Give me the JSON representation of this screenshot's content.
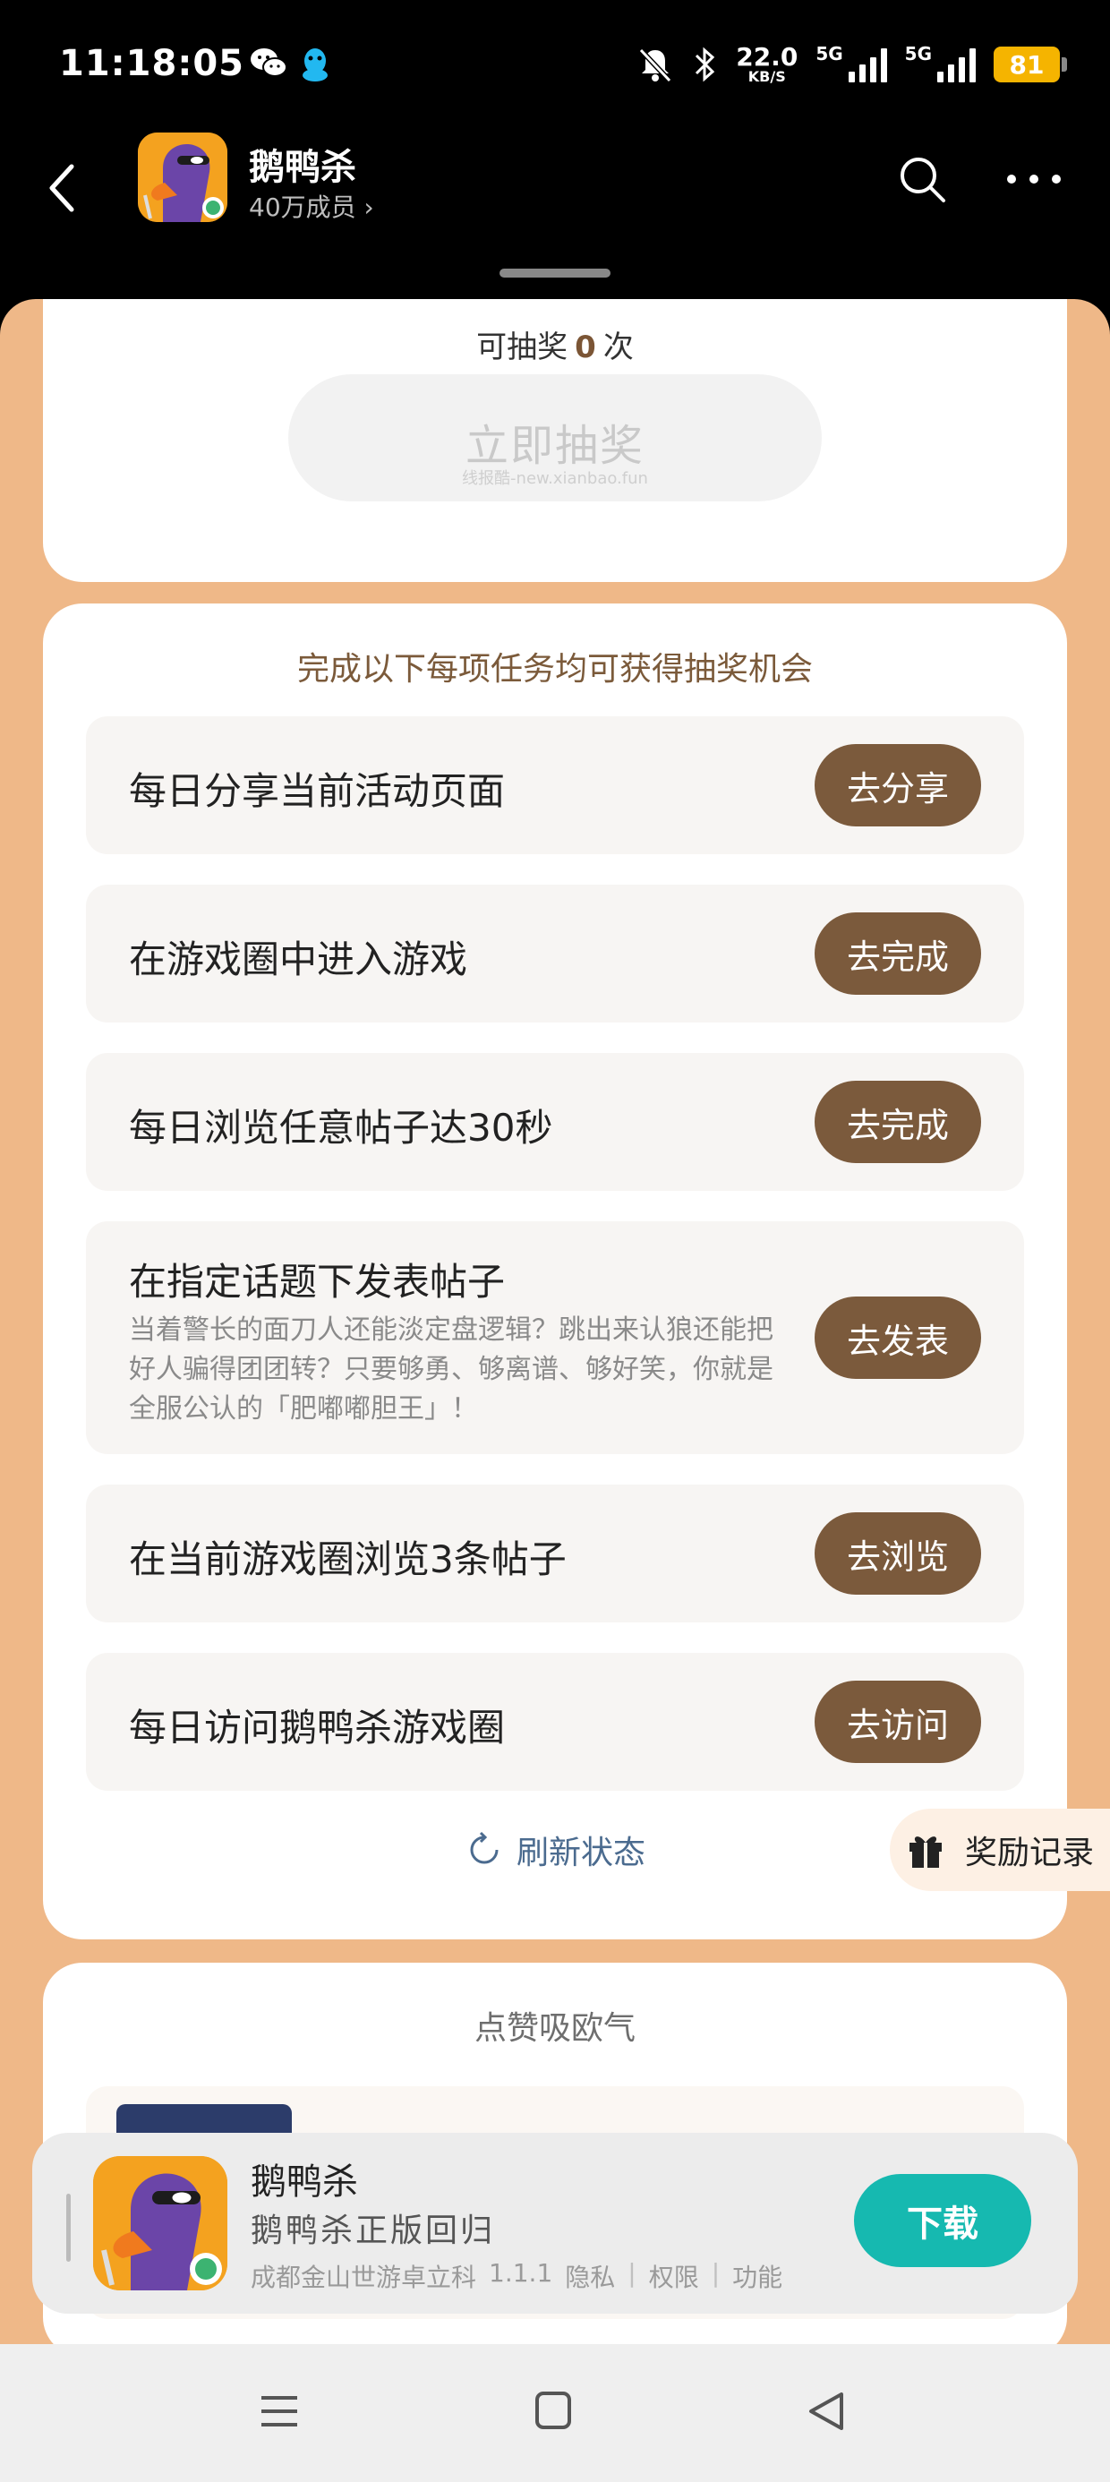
{
  "status_bar": {
    "time": "11:18:05",
    "net_speed": "22.0",
    "net_speed_unit": "KB/S",
    "sim1": "5G",
    "sim2": "5G",
    "battery": "81",
    "icons": [
      "wechat-icon",
      "qq-icon",
      "mute-icon",
      "bluetooth-icon",
      "signal-icon",
      "battery-icon"
    ]
  },
  "header": {
    "title": "鹅鸭杀",
    "members": "40万成员",
    "icons": [
      "back-icon",
      "search-icon",
      "more-icon"
    ]
  },
  "lottery": {
    "count_prefix": "可抽奖",
    "count": "0",
    "count_suffix": "次",
    "draw_button": "立即抽奖",
    "watermark": "线报酷-new.xianbao.fun"
  },
  "tasks": {
    "heading": "完成以下每项任务均可获得抽奖机会",
    "items": [
      {
        "title": "每日分享当前活动页面",
        "button": "去分享"
      },
      {
        "title": "在游戏圈中进入游戏",
        "button": "去完成"
      },
      {
        "title": "每日浏览任意帖子达30秒",
        "button": "去完成"
      },
      {
        "title": "在指定话题下发表帖子",
        "desc": "当着警长的面刀人还能淡定盘逻辑？跳出来认狼还能把好人骗得团团转？只要够勇、够离谱、够好笑，你就是全服公认的「肥嘟嘟胆王」！",
        "button": "去发表"
      },
      {
        "title": "在当前游戏圈浏览3条帖子",
        "button": "去浏览"
      },
      {
        "title": "每日访问鹅鸭杀游戏圈",
        "button": "去访问"
      }
    ],
    "refresh": "刷新状态"
  },
  "reward_record": "奖励记录",
  "likes": {
    "heading": "点赞吸欧气"
  },
  "banner": {
    "app_name": "鹅鸭杀",
    "slogan": "鹅鸭杀正版回归",
    "developer": "成都金山世游卓立科",
    "version": "1.1.1",
    "privacy": "隐私",
    "permissions": "权限",
    "features": "功能",
    "download": "下载"
  },
  "colors": {
    "accent_brown": "#7b5a3c",
    "page_orange": "#efb888",
    "download_teal": "#16b9b0",
    "battery_yellow": "#f5b400"
  }
}
